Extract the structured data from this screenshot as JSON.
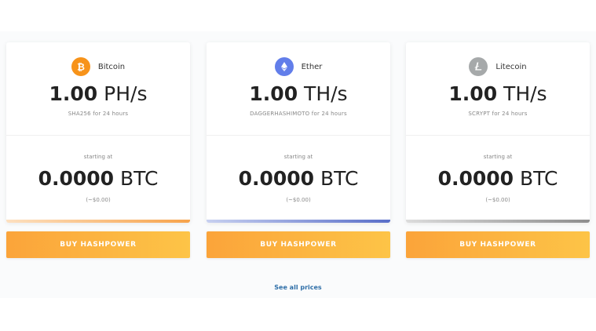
{
  "cards": [
    {
      "coin": "Bitcoin",
      "icon": "bitcoin-icon",
      "icon_color": "#f7931a",
      "hash_value": "1.00",
      "hash_unit": "PH/s",
      "algo": "SHA256 for 24 hours",
      "starting_label": "starting at",
      "price_value": "0.0000",
      "price_unit": "BTC",
      "usd": "(~$0.00)",
      "accent": [
        "#fde0c0",
        "#f7a34b"
      ],
      "button_label": "BUY HASHPOWER"
    },
    {
      "coin": "Ether",
      "icon": "ether-icon",
      "icon_color": "#627eea",
      "hash_value": "1.00",
      "hash_unit": "TH/s",
      "algo": "DAGGERHASHIMOTO for 24 hours",
      "starting_label": "starting at",
      "price_value": "0.0000",
      "price_unit": "BTC",
      "usd": "(~$0.00)",
      "accent": [
        "#c7d0f0",
        "#5a6fc9"
      ],
      "button_label": "BUY HASHPOWER"
    },
    {
      "coin": "Litecoin",
      "icon": "litecoin-icon",
      "icon_color": "#a6a9aa",
      "hash_value": "1.00",
      "hash_unit": "TH/s",
      "algo": "SCRYPT for 24 hours",
      "starting_label": "starting at",
      "price_value": "0.0000",
      "price_unit": "BTC",
      "usd": "(~$0.00)",
      "accent": [
        "#dcdcdc",
        "#8e8e8e"
      ],
      "button_label": "BUY HASHPOWER"
    }
  ],
  "footer": {
    "see_all": "See all prices",
    "link_color": "#2f6fa8"
  }
}
